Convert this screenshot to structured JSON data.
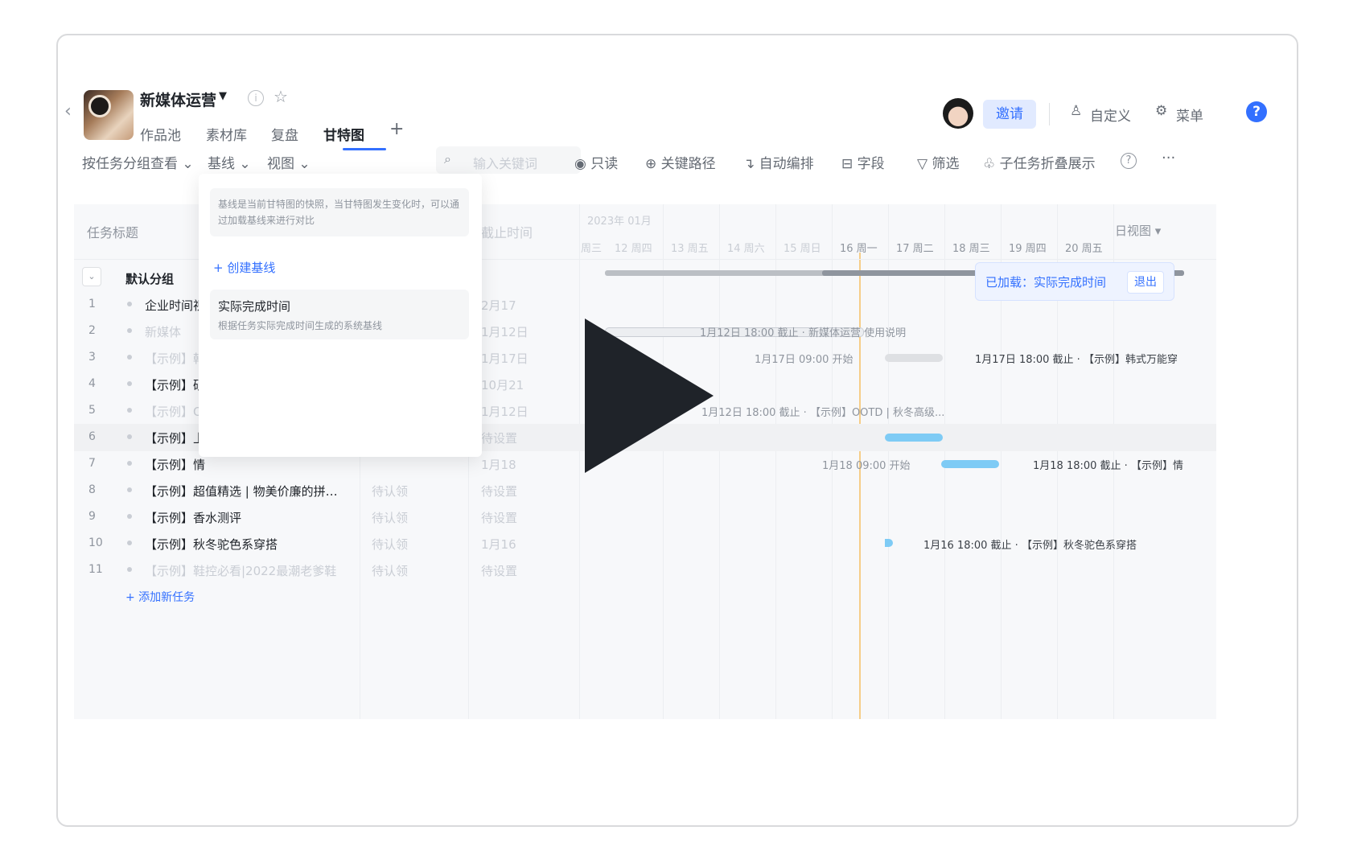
{
  "project": {
    "title": "新媒体运营",
    "tabs": [
      "作品池",
      "素材库",
      "复盘",
      "甘特图"
    ]
  },
  "header_right": {
    "invite": "邀请",
    "customize": "自定义",
    "menu": "菜单",
    "help": "?"
  },
  "toolbar": {
    "group_by": "按任务分组查看",
    "baseline": "基线",
    "view": "视图",
    "search_placeholder": "输入关键词",
    "readonly": "只读",
    "critical_path": "关键路径",
    "auto_schedule": "自动编排",
    "fields": "字段",
    "filter": "筛选",
    "subtask_fold": "子任务折叠展示",
    "more": "···"
  },
  "table": {
    "col_title": "任务标题",
    "col_deadline": "截止时间",
    "group_name": "默认分组",
    "rows": [
      {
        "num": "1",
        "title": "企业时间视",
        "owner": "",
        "deadline": "2月17"
      },
      {
        "num": "2",
        "title": "新媒体",
        "owner": "",
        "deadline": "1月12日"
      },
      {
        "num": "3",
        "title": "【示例】韩",
        "owner": "",
        "deadline": "1月17日"
      },
      {
        "num": "4",
        "title": "【示例】硕",
        "owner": "",
        "deadline": "10月21"
      },
      {
        "num": "5",
        "title": "【示例】O",
        "owner": "",
        "deadline": "1月12日"
      },
      {
        "num": "6",
        "title": "【示例】上",
        "owner": "",
        "deadline": "待设置"
      },
      {
        "num": "7",
        "title": "【示例】情",
        "owner": "",
        "deadline": "1月18"
      },
      {
        "num": "8",
        "title": "【示例】超值精选 | 物美价廉的拼…",
        "owner": "待认领",
        "deadline": "待设置"
      },
      {
        "num": "9",
        "title": "【示例】香水测评",
        "owner": "待认领",
        "deadline": "待设置"
      },
      {
        "num": "10",
        "title": "【示例】秋冬驼色系穿搭",
        "owner": "待认领",
        "deadline": "1月16"
      },
      {
        "num": "11",
        "title": "【示例】鞋控必看|2022最潮老爹鞋",
        "owner": "待认领",
        "deadline": "待设置"
      }
    ],
    "add_task": "+ 添加新任务"
  },
  "gantt": {
    "month": "2023年 01月",
    "days": [
      "周三",
      "12 周四",
      "13 周五",
      "14 周六",
      "15 周日",
      "16 周一",
      "17 周二",
      "18 周三",
      "19 周四",
      "20 周五"
    ],
    "scale": "日视图",
    "labels": {
      "r2": "1月12日 18:00 截止 · 新媒体运营 使用说明",
      "r3_start": "1月17日 09:00 开始",
      "r3_end": "1月17日 18:00 截止 · 【示例】韩式万能穿",
      "r5": "1月12日 18:00 截止 · 【示例】OOTD | 秋冬高级...",
      "r7_start": "1月18 09:00 开始",
      "r7_end": "1月18 18:00 截止 · 【示例】情",
      "r10": "1月16 18:00 截止 · 【示例】秋冬驼色系穿搭"
    },
    "loaded_baseline": "已加载：实际完成时间",
    "exit": "退出"
  },
  "baseline_dropdown": {
    "tip": "基线是当前甘特图的快照，当甘特图发生变化时，可以通过加载基线来进行对比",
    "create": "+ 创建基线",
    "option_title": "实际完成时间",
    "option_desc": "根据任务实际完成时间生成的系统基线"
  },
  "colors": {
    "accent": "#3370ff",
    "bar_blue": "#7ecbf5",
    "today_line": "#f5c26b"
  }
}
